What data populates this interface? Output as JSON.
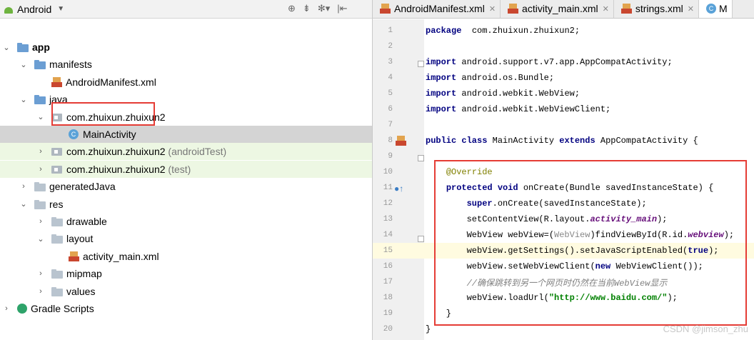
{
  "project_panel": {
    "view": "Android",
    "tree": [
      {
        "label": "app",
        "indent": 0,
        "icon": "module",
        "arrow": "v",
        "bold": true
      },
      {
        "label": "manifests",
        "indent": 1,
        "icon": "folder",
        "arrow": "v"
      },
      {
        "label": "AndroidManifest.xml",
        "indent": 2,
        "icon": "xml-file",
        "arrow": ""
      },
      {
        "label": "java",
        "indent": 1,
        "icon": "folder",
        "arrow": "v"
      },
      {
        "label": "com.zhuixun.zhuixun2",
        "indent": 2,
        "icon": "package",
        "arrow": "v"
      },
      {
        "label": "MainActivity",
        "indent": 3,
        "icon": "class",
        "arrow": "",
        "selected": true
      },
      {
        "label": "com.zhuixun.zhuixun2",
        "suffix": "(androidTest)",
        "indent": 2,
        "icon": "package",
        "arrow": ">",
        "green": true
      },
      {
        "label": "com.zhuixun.zhuixun2",
        "suffix": "(test)",
        "indent": 2,
        "icon": "package",
        "arrow": ">",
        "green": true
      },
      {
        "label": "generatedJava",
        "indent": 1,
        "icon": "folder",
        "arrow": ">"
      },
      {
        "label": "res",
        "indent": 1,
        "icon": "folder",
        "arrow": "v"
      },
      {
        "label": "drawable",
        "indent": 2,
        "icon": "folder",
        "arrow": ">"
      },
      {
        "label": "layout",
        "indent": 2,
        "icon": "folder",
        "arrow": "v"
      },
      {
        "label": "activity_main.xml",
        "indent": 3,
        "icon": "xml-file",
        "arrow": ""
      },
      {
        "label": "mipmap",
        "indent": 2,
        "icon": "folder",
        "arrow": ">"
      },
      {
        "label": "values",
        "indent": 2,
        "icon": "folder",
        "arrow": ">"
      },
      {
        "label": "Gradle Scripts",
        "indent": 0,
        "icon": "gradle",
        "arrow": ">"
      }
    ]
  },
  "tabs": [
    {
      "label": "AndroidManifest.xml",
      "icon": "xml-file"
    },
    {
      "label": "activity_main.xml",
      "icon": "xml-file"
    },
    {
      "label": "strings.xml",
      "icon": "xml-file"
    },
    {
      "label": "M",
      "icon": "class",
      "active": true
    }
  ],
  "code": [
    {
      "n": "1",
      "t": [
        [
          "kw",
          "package"
        ],
        [
          "",
          "  com.zhuixun.zhuixun2;"
        ]
      ]
    },
    {
      "n": "2",
      "t": []
    },
    {
      "n": "3",
      "t": [
        [
          "kw",
          "import"
        ],
        [
          "",
          " android.support.v7.app.AppCompatActivity;"
        ]
      ]
    },
    {
      "n": "4",
      "t": [
        [
          "kw",
          "import"
        ],
        [
          "",
          " android.os.Bundle;"
        ]
      ]
    },
    {
      "n": "5",
      "t": [
        [
          "kw",
          "import"
        ],
        [
          "",
          " android.webkit.WebView;"
        ]
      ]
    },
    {
      "n": "6",
      "t": [
        [
          "kw",
          "import"
        ],
        [
          "",
          " android.webkit.WebViewClient;"
        ]
      ]
    },
    {
      "n": "7",
      "t": []
    },
    {
      "n": "8",
      "t": [
        [
          "kw",
          "public class"
        ],
        [
          "",
          " MainActivity "
        ],
        [
          "kw",
          "extends"
        ],
        [
          "",
          " AppCompatActivity {"
        ]
      ]
    },
    {
      "n": "9",
      "t": []
    },
    {
      "n": "10",
      "t": [
        [
          "",
          "    "
        ],
        [
          "an",
          "@Override"
        ]
      ]
    },
    {
      "n": "11",
      "t": [
        [
          "",
          "    "
        ],
        [
          "kw",
          "protected void"
        ],
        [
          "",
          " onCreate(Bundle savedInstanceState) {"
        ]
      ]
    },
    {
      "n": "12",
      "t": [
        [
          "",
          "        "
        ],
        [
          "kw",
          "super"
        ],
        [
          "",
          ".onCreate(savedInstanceState);"
        ]
      ]
    },
    {
      "n": "13",
      "t": [
        [
          "",
          "        setContentView(R.layout."
        ],
        [
          "fld",
          "activity_main"
        ],
        [
          "",
          ");"
        ]
      ]
    },
    {
      "n": "14",
      "t": [
        [
          "",
          "        WebView webView=("
        ],
        [
          "hint",
          "WebView"
        ],
        [
          "",
          ")findViewById(R.id."
        ],
        [
          "fld",
          "webview"
        ],
        [
          "",
          ");"
        ]
      ]
    },
    {
      "n": "15",
      "t": [
        [
          "",
          "        webView.getSettings().setJavaScriptEnabled("
        ],
        [
          "kw",
          "true"
        ],
        [
          "",
          ");"
        ]
      ],
      "hl": true
    },
    {
      "n": "16",
      "t": [
        [
          "",
          "        webView.setWebViewClient("
        ],
        [
          "kw",
          "new"
        ],
        [
          "",
          " WebViewClient());"
        ]
      ]
    },
    {
      "n": "17",
      "t": [
        [
          "",
          "        "
        ],
        [
          "cm",
          "//确保跳转到另一个网页时仍然在当前WebView显示"
        ]
      ]
    },
    {
      "n": "18",
      "t": [
        [
          "",
          "        webView.loadUrl("
        ],
        [
          "str",
          "\"http://www.baidu.com/\""
        ],
        [
          "",
          ");"
        ]
      ]
    },
    {
      "n": "19",
      "t": [
        [
          "",
          "    }"
        ]
      ]
    },
    {
      "n": "20",
      "t": [
        [
          "",
          "}"
        ]
      ]
    }
  ],
  "watermark": "CSDN @jimson_zhu"
}
